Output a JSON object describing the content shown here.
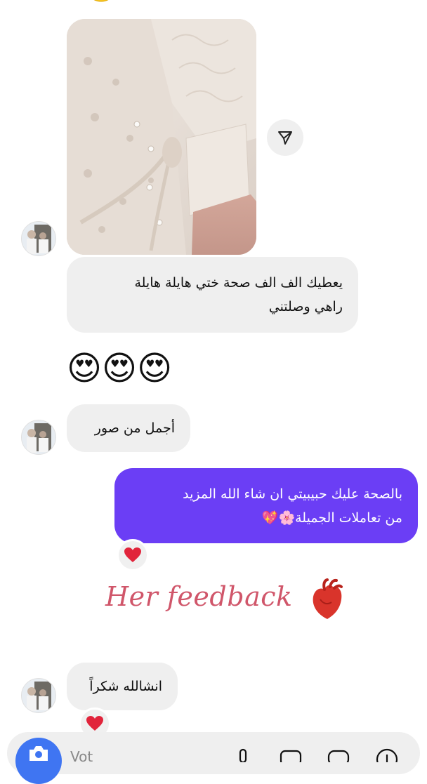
{
  "messages": {
    "received_1": {
      "line1": "يعطيك الف الف صحة ختي هايلة هايلة",
      "line2": "راهي وصلتني"
    },
    "received_2": "أجمل من صور",
    "sent_1": {
      "line1": "بالصحة عليك حبيبيتي ان شاء الله المزيد",
      "line2": "من تعاملات الجميلة🌸💖"
    },
    "received_3": "انشالله شكراً"
  },
  "emoji_reaction": "😍😍😍",
  "overlay": {
    "feedback_text": "Her feedback"
  },
  "composer": {
    "placeholder_partial": "Vot"
  },
  "colors": {
    "sent_bubble": "#6b3ef5",
    "received_bubble": "#efefef",
    "camera_button": "#3f75f2",
    "feedback_text": "#d0566a",
    "heart_reaction": "#e1243b"
  },
  "icons": {
    "share": "send-icon",
    "reaction": "heart-icon",
    "camera": "camera-icon",
    "mic": "mic-icon",
    "gallery": "gallery-icon",
    "sticker": "sticker-icon",
    "add": "add-icon"
  }
}
